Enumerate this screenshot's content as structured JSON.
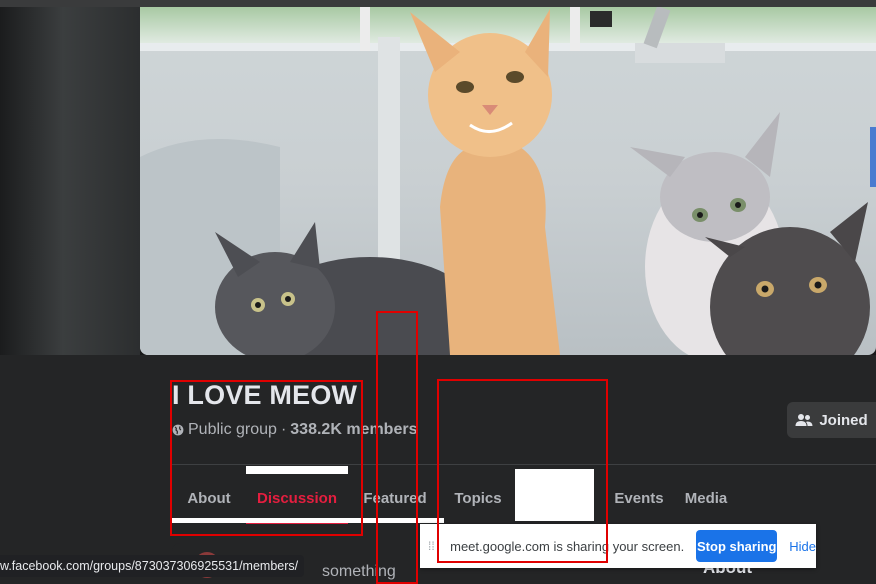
{
  "group": {
    "name": "I LOVE MEOW",
    "privacy": "Public group",
    "separator": "·",
    "members": "338.2K members",
    "joined_label": "Joined"
  },
  "tabs": [
    {
      "label": "About",
      "active": false
    },
    {
      "label": "Discussion",
      "active": true
    },
    {
      "label": "Featured",
      "active": false
    },
    {
      "label": "Topics",
      "active": false
    },
    {
      "label": "",
      "active": false
    },
    {
      "label": "Events",
      "active": false
    },
    {
      "label": "Media",
      "active": false
    }
  ],
  "composer": {
    "placeholder_fragment": "something"
  },
  "right_panel": {
    "heading": "About"
  },
  "status_bar": {
    "url": "w.facebook.com/groups/873037306925531/members/"
  },
  "screen_share": {
    "message": "meet.google.com is sharing your screen.",
    "stop_label": "Stop sharing",
    "hide_label": "Hide"
  },
  "colors": {
    "accent_active_tab": "#e41e3f",
    "share_button": "#1a73e8",
    "annotation_box": "#e00000"
  },
  "icons": {
    "privacy": "globe-icon",
    "joined": "people-icon"
  }
}
